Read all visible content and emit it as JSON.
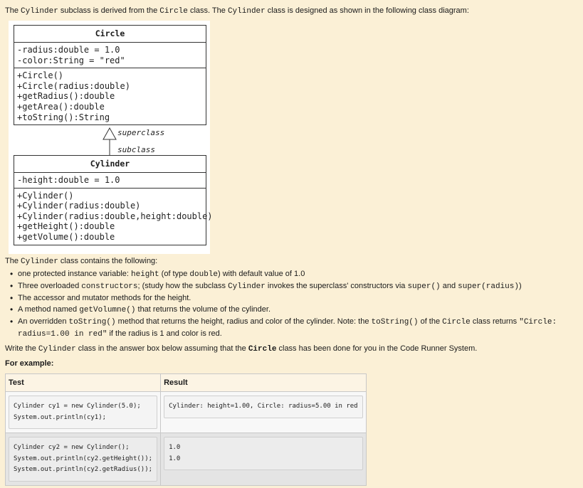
{
  "intro": {
    "t1": "The ",
    "c1": "Cylinder",
    "t2": " subclass is derived from the ",
    "c2": "Circle",
    "t3": " class. The ",
    "c3": "Cylinder",
    "t4": " class is designed as shown in the following class diagram:"
  },
  "uml": {
    "circle": {
      "name": "Circle",
      "fields": [
        "-radius:double = 1.0",
        "-color:String = \"red\""
      ],
      "methods": [
        "+Circle()",
        "+Circle(radius:double)",
        "+getRadius():double",
        "+getArea():double",
        "+toString():String"
      ]
    },
    "superclass_label": "superclass",
    "subclass_label": "subclass",
    "cylinder": {
      "name": "Cylinder",
      "fields": [
        "-height:double = 1.0"
      ],
      "methods": [
        "+Cylinder()",
        "+Cylinder(radius:double)",
        "+Cylinder(radius:double,height:double)",
        "+getHeight():double",
        "+getVolume():double"
      ]
    }
  },
  "contains": {
    "t1": "The ",
    "c1": "Cylinder",
    "t2": " class contains the following:"
  },
  "features": {
    "f1": {
      "t1": "one protected instance variable: ",
      "c1": "height",
      "t2": " (of type ",
      "c2": "double",
      "t3": ") with default value of 1.0"
    },
    "f2": {
      "t1": "Three overloaded ",
      "c1": "constructors",
      "t2": "; (study how the subclass ",
      "c2": "Cylinder",
      "t3": " invokes the superclass' constructors via ",
      "c3": "super()",
      "t4": " and ",
      "c4": "super(radius)",
      "t5": ")"
    },
    "f3": {
      "t1": "The accessor and mutator methods for the height."
    },
    "f4": {
      "t1": "A method named ",
      "c1": "getVolumne()",
      "t2": " that returns the volume of the cylinder."
    },
    "f5": {
      "t1": "An overridden ",
      "c1": "toString()",
      "t2": " method that returns the height, radius and color of the cylinder. Note: the ",
      "c2": "toString()",
      "t3": " of the ",
      "c3": "Circle",
      "t4": " class returns ",
      "c4": "\"Circle:",
      "c5": "radius=1.00 in red\"",
      "t5": " if the radius is 1 and color is red."
    }
  },
  "write": {
    "t1": "Write the ",
    "c1": "Cylinder",
    "t2": " class in the answer box below assuming that the ",
    "c2": "Circle",
    "t3": " class has been done for you in the Code Runner System."
  },
  "for_example": "For example:",
  "examples": {
    "headers": [
      "Test",
      "Result"
    ],
    "rows": [
      {
        "test": "Cylinder cy1 = new Cylinder(5.0);\nSystem.out.println(cy1);",
        "result": "Cylinder: height=1.00, Circle: radius=5.00 in red"
      },
      {
        "test": "Cylinder cy2 = new Cylinder();\nSystem.out.println(cy2.getHeight());\nSystem.out.println(cy2.getRadius());",
        "result": "1.0\n1.0"
      }
    ]
  }
}
